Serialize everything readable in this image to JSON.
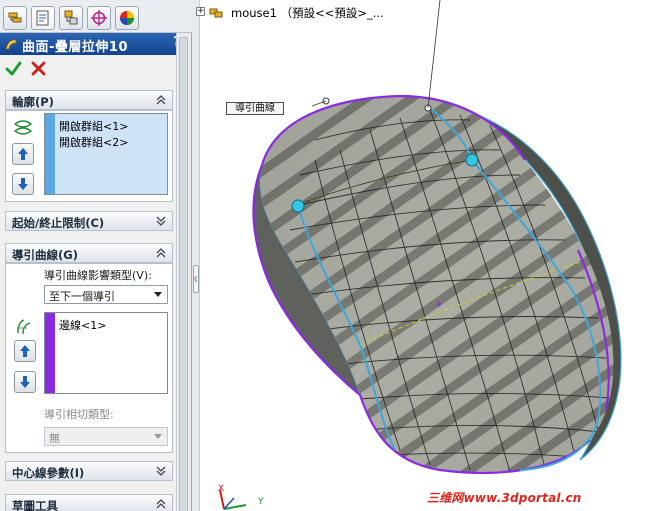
{
  "property_manager": {
    "tabs": [
      {
        "icon": "feature-manager-icon"
      },
      {
        "icon": "property-manager-icon"
      },
      {
        "icon": "configuration-manager-icon"
      },
      {
        "icon": "dimxpert-icon"
      },
      {
        "icon": "display-manager-icon"
      }
    ],
    "title": "曲面-疊層拉伸10",
    "help_label": "?",
    "sections": {
      "profiles": {
        "title": "輪廓(P)",
        "items": [
          "開啟群組<1>",
          "開啟群組<2>"
        ]
      },
      "start_end": {
        "title": "起始/終止限制(C)"
      },
      "guide_curves": {
        "title": "導引曲線(G)",
        "influence_label": "導引曲線影響類型(V):",
        "influence_value": "至下一個導引",
        "items": [
          "邊線<1>"
        ],
        "tangency_label": "導引相切類型:",
        "tangency_value": "無"
      },
      "centerline": {
        "title": "中心線參數(I)"
      },
      "sketch_tools": {
        "title": "草圖工具"
      }
    }
  },
  "graphics": {
    "tree_root": "mouse1 （預設<<預設>_...",
    "callout": "導引曲線",
    "watermark": "三维网www.3dportal.cn",
    "triad_x": "X",
    "triad_y": "Y"
  },
  "colors": {
    "title_bar": "#1d4f9e",
    "profile_selection": "#5aa9e6",
    "guide_selection": "#8a2be2",
    "surface": "#8f8f86",
    "edge_purple": "#8a2be2",
    "edge_cyan": "#3fa6d9"
  }
}
